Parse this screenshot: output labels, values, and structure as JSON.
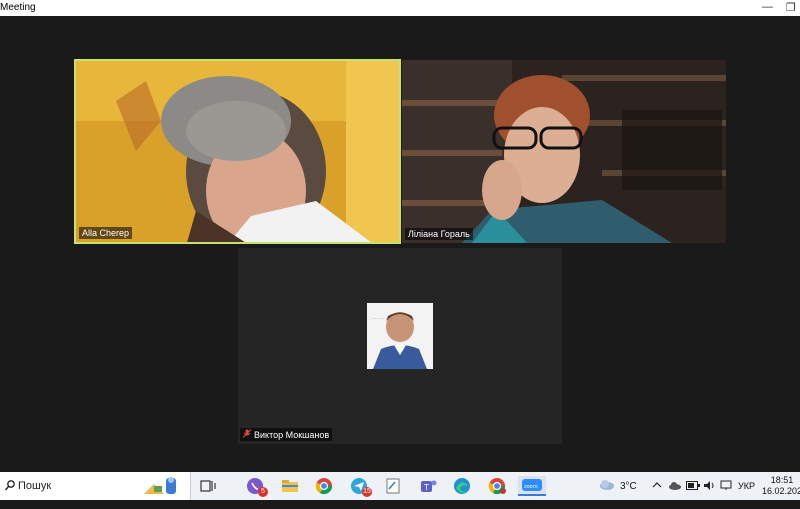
{
  "window": {
    "title": "Meeting"
  },
  "participants": [
    {
      "name": "Alla Cherep",
      "active_speaker": true
    },
    {
      "name": "Ліліана Гораль",
      "active_speaker": false
    },
    {
      "name": "Виктор Мокшанов",
      "muted": true
    }
  ],
  "taskbar": {
    "search_placeholder": "Пошук",
    "badges": {
      "viber": "5",
      "telegram": "15"
    },
    "weather": "3°C",
    "language": "УКР",
    "time": "18:51",
    "date": "16.02.202"
  },
  "colors": {
    "active_speaker_border": "#c6e26b",
    "muted": "#e0483e",
    "stage_bg": "#1a1a1a"
  }
}
